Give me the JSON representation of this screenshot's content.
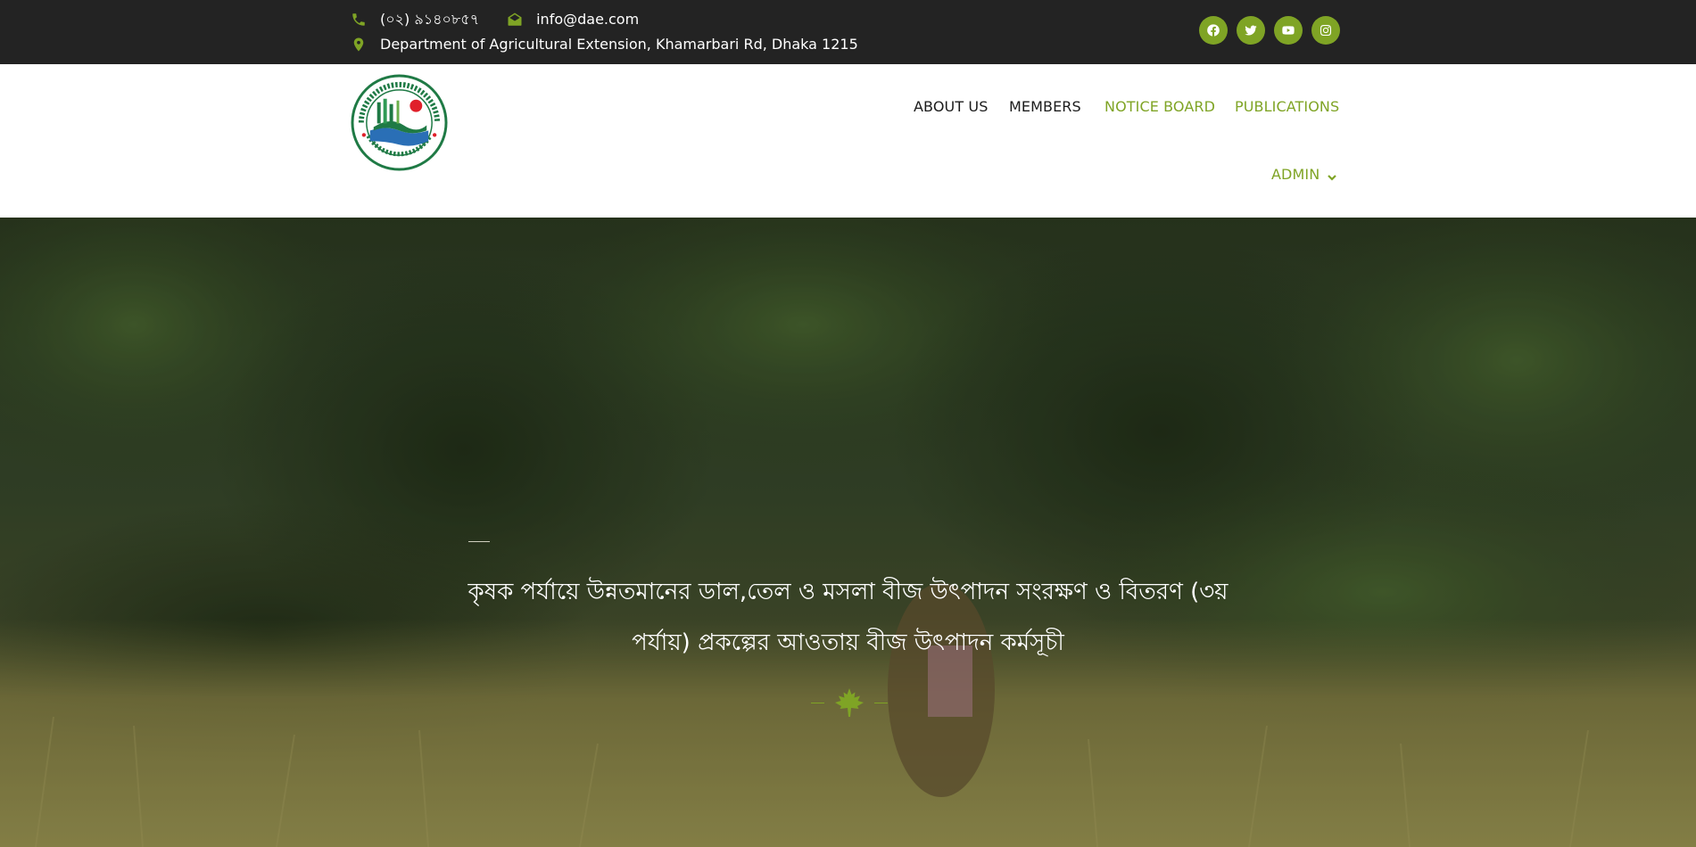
{
  "topbar": {
    "phone": "(০২) ৯১৪০৮৫৭",
    "email": "info@dae.com",
    "address": "Department of Agricultural Extension, Khamarbari Rd, Dhaka 1215",
    "social": [
      "facebook-icon",
      "twitter-icon",
      "youtube-icon",
      "instagram-icon"
    ]
  },
  "header": {
    "logo": "dae-logo",
    "nav": {
      "about": "ABOUT US",
      "members": "MEMBERS",
      "notice": "NOTICE BOARD",
      "publications": "PUBLICATIONS",
      "admin": "ADMIN"
    }
  },
  "hero": {
    "headline": "কৃষক পর্যায়ে উন্নতমানের ডাল,তেল ও মসলা বীজ উৎপাদন সংরক্ষণ ও বিতরণ (৩য় পর্যায়) প্রকল্পের আওতায় বীজ উৎপাদন কর্মসূচী",
    "divider_icon": "maple-leaf-icon"
  },
  "colors": {
    "accent": "#7fa425",
    "topbar_bg": "#232323",
    "nav_text": "#1b1b1b"
  }
}
